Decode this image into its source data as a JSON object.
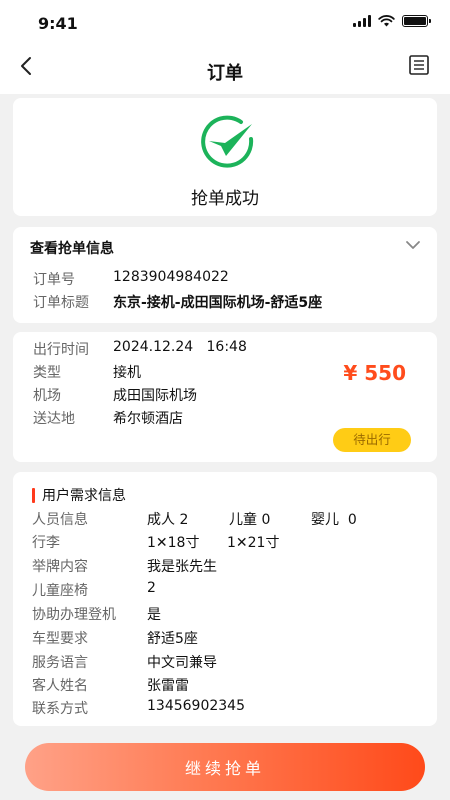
{
  "status_bar": {
    "time": "9:41"
  },
  "nav": {
    "title": "订单"
  },
  "success": {
    "label": "抢单成功"
  },
  "order_info": {
    "header": "查看抢单信息",
    "order_no_label": "订单号",
    "order_no": "1283904984022",
    "title_label": "订单标题",
    "title": "东京-接机-成田国际机场-舒适5座"
  },
  "trip": {
    "time_label": "出行时间",
    "time": "2024.12.24   16:48",
    "type_label": "类型",
    "type": "接机",
    "airport_label": "机场",
    "airport": "成田国际机场",
    "dest_label": "送达地",
    "dest": "希尔顿酒店",
    "price": "¥ 550",
    "status_badge": "待出行"
  },
  "requirements": {
    "title": "用户需求信息",
    "people_label": "人员信息",
    "adult": "成人 2",
    "child": "儿童 0",
    "infant": "婴儿  0",
    "luggage_label": "行李",
    "luggage_1": "1✕18寸",
    "luggage_2": "1✕21寸",
    "sign_label": "举牌内容",
    "sign": "我是张先生",
    "seat_label": "儿童座椅",
    "seat": "2",
    "checkin_label": "协助办理登机",
    "checkin": "是",
    "car_label": "车型要求",
    "car": "舒适5座",
    "lang_label": "服务语言",
    "lang": "中文司兼导",
    "guest_label": "客人姓名",
    "guest": "张雷雷",
    "contact_label": "联系方式",
    "contact": "13456902345"
  },
  "cta": {
    "label": "继续抢单"
  },
  "colors": {
    "accent": "#ff4c1c",
    "success": "#1cb35a",
    "badge": "#ffcc15"
  }
}
